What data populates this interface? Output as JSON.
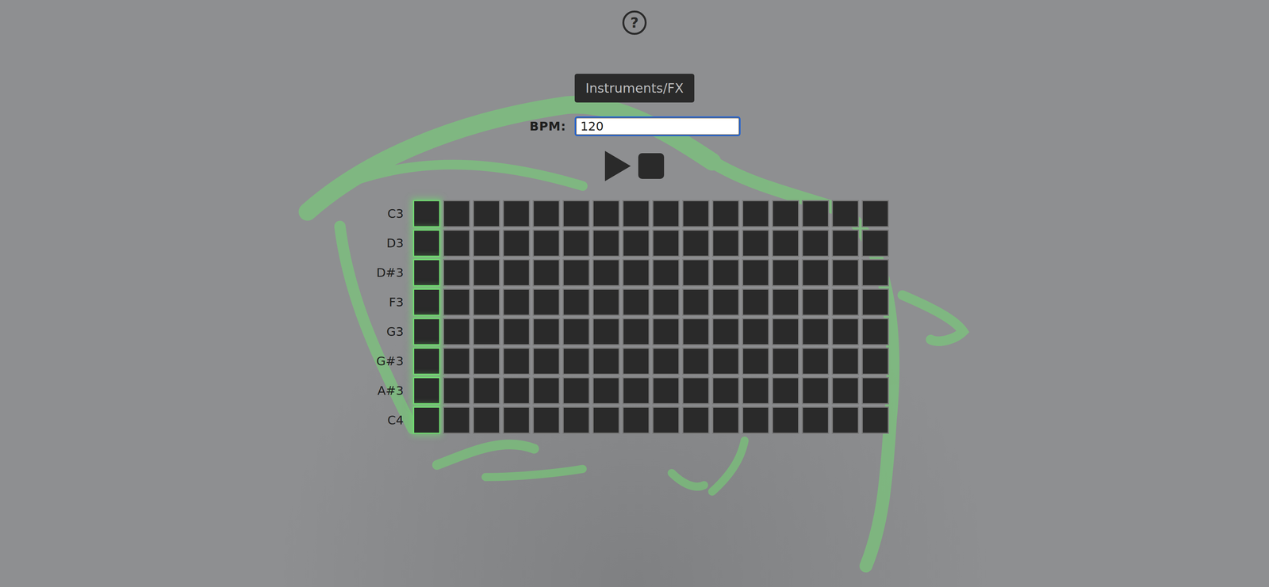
{
  "help": {
    "label": "?"
  },
  "instruments_button": {
    "label": "Instruments/FX"
  },
  "bpm": {
    "label": "BPM:",
    "value": "120",
    "focused": true
  },
  "steps": [
    {
      "current": true
    },
    {
      "current": false
    },
    {
      "current": false
    },
    {
      "current": false
    },
    {
      "current": false
    },
    {
      "current": false
    },
    {
      "current": false
    },
    {
      "current": false
    },
    {
      "current": false
    },
    {
      "current": false
    },
    {
      "current": false
    },
    {
      "current": false
    },
    {
      "current": false
    },
    {
      "current": false
    },
    {
      "current": false
    },
    {
      "current": false
    }
  ],
  "rows": [
    {
      "note": "C3",
      "cells": [
        false,
        false,
        false,
        false,
        false,
        false,
        false,
        false,
        false,
        false,
        false,
        false,
        false,
        false,
        false,
        false
      ]
    },
    {
      "note": "D3",
      "cells": [
        false,
        false,
        false,
        false,
        false,
        false,
        false,
        false,
        false,
        false,
        false,
        false,
        false,
        false,
        false,
        false
      ]
    },
    {
      "note": "D#3",
      "cells": [
        false,
        false,
        false,
        false,
        false,
        false,
        false,
        false,
        false,
        false,
        false,
        false,
        false,
        false,
        false,
        false
      ]
    },
    {
      "note": "F3",
      "cells": [
        false,
        false,
        false,
        false,
        false,
        false,
        false,
        false,
        false,
        false,
        false,
        false,
        false,
        false,
        false,
        false
      ]
    },
    {
      "note": "G3",
      "cells": [
        false,
        false,
        false,
        false,
        false,
        false,
        false,
        false,
        false,
        false,
        false,
        false,
        false,
        false,
        false,
        false
      ]
    },
    {
      "note": "G#3",
      "cells": [
        false,
        false,
        false,
        false,
        false,
        false,
        false,
        false,
        false,
        false,
        false,
        false,
        false,
        false,
        false,
        false
      ]
    },
    {
      "note": "A#3",
      "cells": [
        false,
        false,
        false,
        false,
        false,
        false,
        false,
        false,
        false,
        false,
        false,
        false,
        false,
        false,
        false,
        false
      ]
    },
    {
      "note": "C4",
      "cells": [
        false,
        false,
        false,
        false,
        false,
        false,
        false,
        false,
        false,
        false,
        false,
        false,
        false,
        false,
        false,
        false
      ]
    }
  ]
}
